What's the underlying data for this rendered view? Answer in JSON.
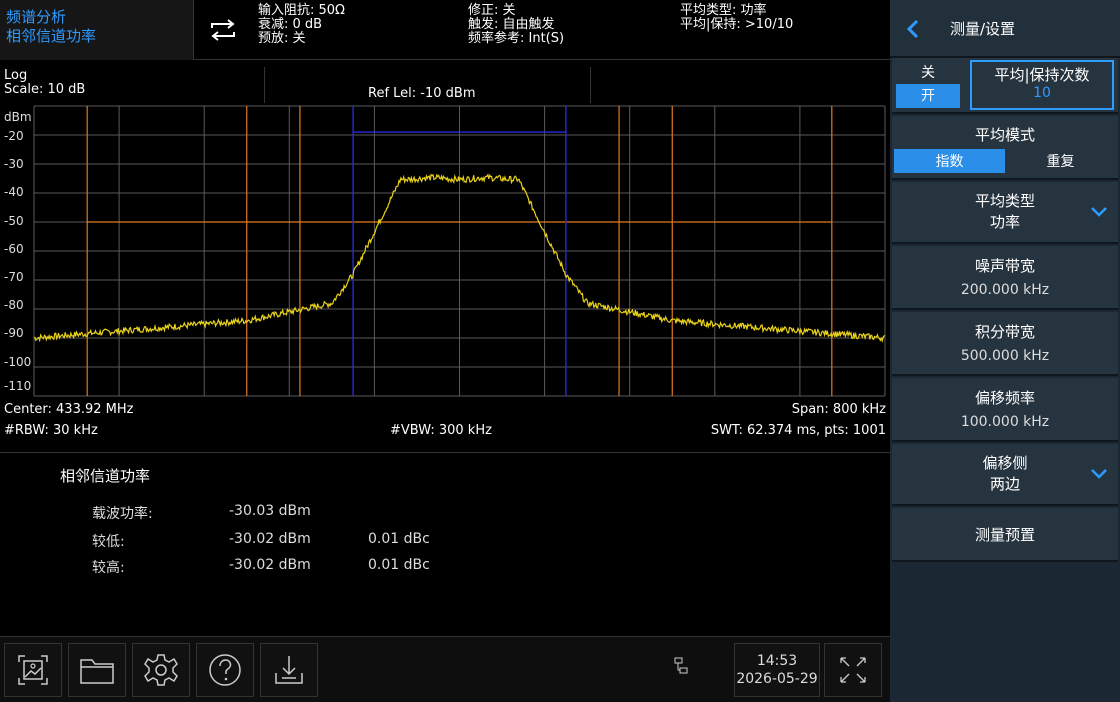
{
  "topbar": {
    "mode_line1": "频谱分析",
    "mode_line2": "相邻信道功率",
    "col1": [
      "输入阻抗: 50Ω",
      "衰减: 0 dB",
      "预放: 关"
    ],
    "col2": [
      "修正: 关",
      "触发: 自由触发",
      "频率参考: Int(S)"
    ],
    "col3": [
      "平均类型: 功率",
      "平均|保持: >10/10"
    ]
  },
  "graph_header": {
    "log": "Log",
    "scale": "Scale: 10 dB",
    "ref_level": "Ref Lel: -10 dBm"
  },
  "y_axis": {
    "unit": "dBm",
    "labels": [
      "-20",
      "-30",
      "-40",
      "-50",
      "-60",
      "-70",
      "-80",
      "-90",
      "-100",
      "-110"
    ]
  },
  "graph_footer": {
    "center": "Center: 433.92 MHz",
    "rbw": "#RBW: 30 kHz",
    "vbw": "#VBW: 300 kHz",
    "span": "Span: 800 kHz",
    "swt": "SWT: 62.374 ms, pts: 1001"
  },
  "results": {
    "title": "相邻信道功率",
    "rows": [
      {
        "label": "载波功率:",
        "power": "-30.03 dBm",
        "rel": ""
      },
      {
        "label": "较低:",
        "power": "-30.02 dBm",
        "rel": "0.01 dBc"
      },
      {
        "label": "较高:",
        "power": "-30.02 dBm",
        "rel": "0.01 dBc"
      }
    ]
  },
  "toolbar": {
    "time": "14:53",
    "date": "2026-05-29"
  },
  "panel": {
    "title": "测量/设置",
    "avg_hold": {
      "off": "关",
      "on": "开",
      "label": "平均|保持次数",
      "value": "10"
    },
    "avg_mode": {
      "label": "平均模式",
      "opt1": "指数",
      "opt2": "重复"
    },
    "avg_type": {
      "label": "平均类型",
      "value": "功率"
    },
    "noise_bw": {
      "label": "噪声带宽",
      "value": "200.000 kHz"
    },
    "integ_bw": {
      "label": "积分带宽",
      "value": "500.000 kHz"
    },
    "offset_freq": {
      "label": "偏移频率",
      "value": "100.000 kHz"
    },
    "offset_side": {
      "label": "偏移侧",
      "value": "两边"
    },
    "preset": {
      "label": "测量预置"
    }
  },
  "colors": {
    "accent": "#2e9bff",
    "trace": "#e8d21a",
    "marker": "#e07a20",
    "channel": "#2a2ad8",
    "panel_bg": "#1b2833"
  }
}
